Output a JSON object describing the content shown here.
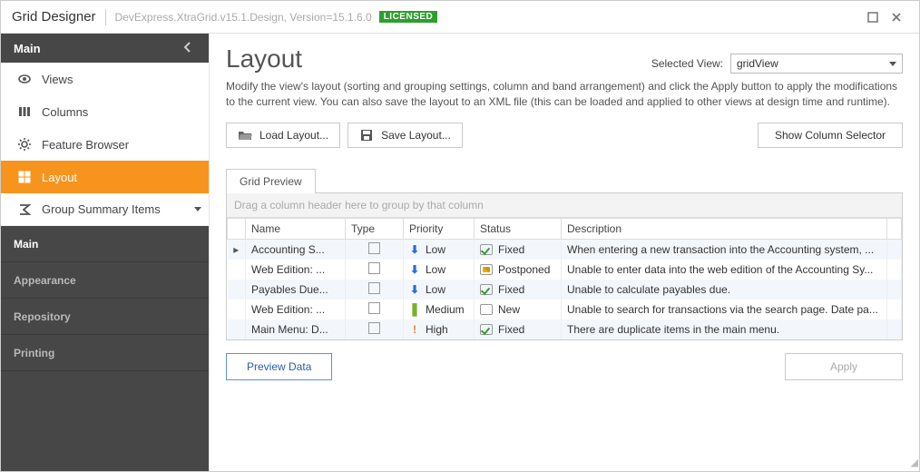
{
  "winTitle": "Grid Designer",
  "assembly": "DevExpress.XtraGrid.v15.1.Design, Version=15.1.6.0",
  "licenseBadge": "LICENSED",
  "sidebar": {
    "topSection": "Main",
    "items": [
      {
        "label": "Views"
      },
      {
        "label": "Columns"
      },
      {
        "label": "Feature Browser"
      },
      {
        "label": "Layout"
      },
      {
        "label": "Group Summary Items"
      }
    ],
    "accordion": [
      {
        "label": "Main"
      },
      {
        "label": "Appearance"
      },
      {
        "label": "Repository"
      },
      {
        "label": "Printing"
      }
    ]
  },
  "page": {
    "title": "Layout",
    "selectedViewLabel": "Selected View:",
    "selectedViewValue": "gridView",
    "description": "Modify the view's layout (sorting and grouping settings, column and band arrangement) and click the Apply button to apply the modifications to the current view. You can also save the layout to an XML file (this can be loaded and applied to other views at design time and runtime).",
    "buttons": {
      "loadLayout": "Load Layout...",
      "saveLayout": "Save Layout...",
      "showColumnSelector": "Show Column Selector",
      "previewData": "Preview Data",
      "apply": "Apply"
    },
    "tab": "Grid Preview",
    "groupPanelHint": "Drag a column header here to group by that column",
    "columns": [
      "Name",
      "Type",
      "Priority",
      "Status",
      "Description"
    ],
    "rows": [
      {
        "name": "Accounting S...",
        "priority": "Low",
        "priorityIcon": "down",
        "status": "Fixed",
        "statusKind": "fixed",
        "desc": "When entering a new transaction into the Accounting system, ...",
        "selected": true
      },
      {
        "name": "Web Edition: ...",
        "priority": "Low",
        "priorityIcon": "down",
        "status": "Postponed",
        "statusKind": "postponed",
        "desc": "Unable to enter data into the web edition of the Accounting Sy..."
      },
      {
        "name": "Payables Due...",
        "priority": "Low",
        "priorityIcon": "down",
        "status": "Fixed",
        "statusKind": "fixed",
        "desc": "Unable to calculate payables due."
      },
      {
        "name": "Web Edition: ...",
        "priority": "Medium",
        "priorityIcon": "mid",
        "status": "New",
        "statusKind": "new",
        "desc": "Unable to search for transactions via the search page. Date pa..."
      },
      {
        "name": "Main Menu: D...",
        "priority": "High",
        "priorityIcon": "bang",
        "status": "Fixed",
        "statusKind": "fixed",
        "desc": "There are duplicate items in the main menu."
      }
    ]
  }
}
